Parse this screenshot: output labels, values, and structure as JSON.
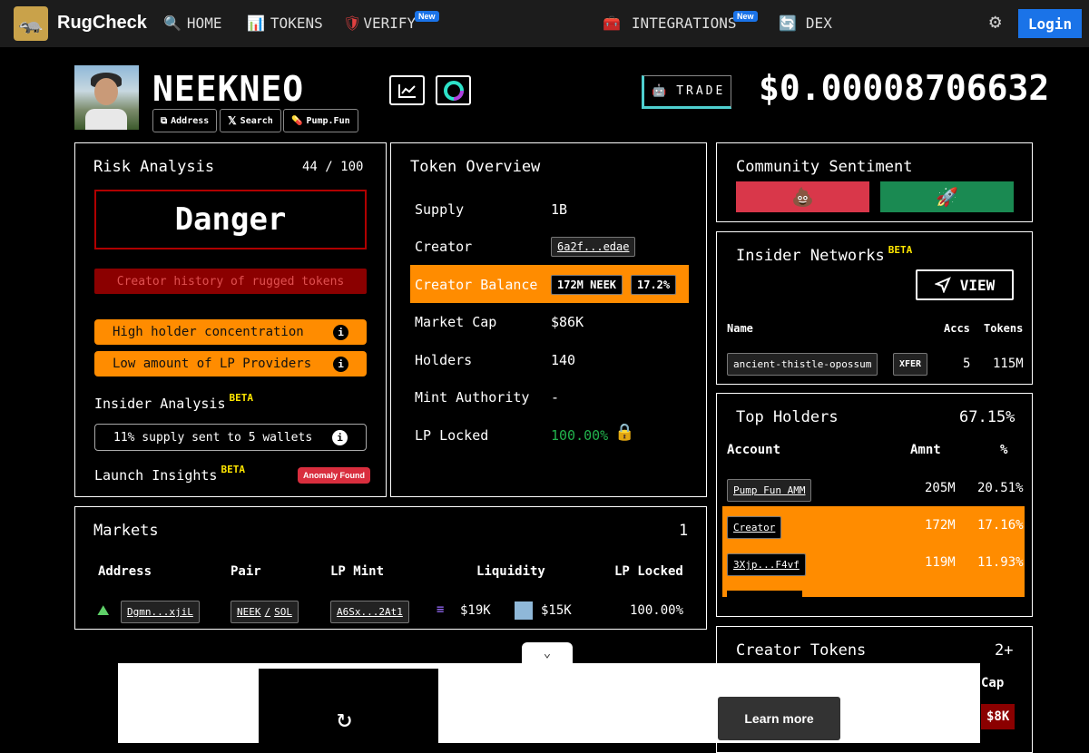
{
  "nav": {
    "brand": "RugCheck",
    "home": "HOME",
    "tokens": "TOKENS",
    "verify": "VERIFY",
    "new_badge": "New",
    "integrations": "INTEGRATIONS",
    "dex": "DEX",
    "login": "Login"
  },
  "token": {
    "name": "NEEKNEO",
    "address_label": "Address",
    "search_label": "Search",
    "pumpfun_label": "Pump.Fun",
    "trade_label": "TRADE",
    "price": "$0.00008706632"
  },
  "risk": {
    "title": "Risk Analysis",
    "score": "44 / 100",
    "level": "Danger",
    "flag_creator": "Creator history of rugged tokens",
    "flag_holder": "High holder concentration",
    "flag_lp": "Low amount of LP Providers",
    "insider_title": "Insider Analysis",
    "beta": "BETA",
    "insider_note": "11% supply sent to 5 wallets",
    "launch_title": "Launch Insights",
    "anomaly": "Anomaly Found"
  },
  "overview": {
    "title": "Token Overview",
    "supply_label": "Supply",
    "supply": "1B",
    "creator_label": "Creator",
    "creator": "6a2f...edae",
    "balance_label": "Creator Balance",
    "balance_amt": "172M NEEK",
    "balance_pct": "17.2%",
    "mcap_label": "Market Cap",
    "mcap": "$86K",
    "holders_label": "Holders",
    "holders": "140",
    "mint_label": "Mint Authority",
    "mint": "-",
    "lp_label": "LP Locked",
    "lp": "100.00%"
  },
  "sentiment": {
    "title": "Community Sentiment"
  },
  "insiders": {
    "title": "Insider Networks",
    "beta": "BETA",
    "view": "VIEW",
    "col_name": "Name",
    "col_accs": "Accs",
    "col_tokens": "Tokens",
    "row_name": "ancient-thistle-opossum",
    "row_tag": "XFER",
    "row_accs": "5",
    "row_tokens": "115M"
  },
  "holders": {
    "title": "Top Holders",
    "total": "67.15%",
    "col_account": "Account",
    "col_amnt": "Amnt",
    "col_pct": "%",
    "rows": [
      {
        "account": "Pump Fun AMM",
        "amnt": "205M",
        "pct": "20.51%"
      },
      {
        "account": "Creator",
        "amnt": "172M",
        "pct": "17.16%"
      },
      {
        "account": "3Xjp...F4vf",
        "amnt": "119M",
        "pct": "11.93%"
      }
    ]
  },
  "markets": {
    "title": "Markets",
    "count": "1",
    "col_address": "Address",
    "col_pair": "Pair",
    "col_lpmint": "LP Mint",
    "col_liq": "Liquidity",
    "col_lplocked": "LP Locked",
    "address": "Dgmn...xjiL",
    "pair_a": "NEEK",
    "pair_sep": "/",
    "pair_b": "SOL",
    "lpmint": "A6Sx...2At1",
    "liq_a": "$19K",
    "liq_b": "$15K",
    "lplocked": "100.00%"
  },
  "creator_tokens": {
    "title": "Creator Tokens",
    "count": "2+",
    "col_cap": "Cap",
    "cap_value": "$8K"
  },
  "ad": {
    "learn_more": "Learn more"
  }
}
